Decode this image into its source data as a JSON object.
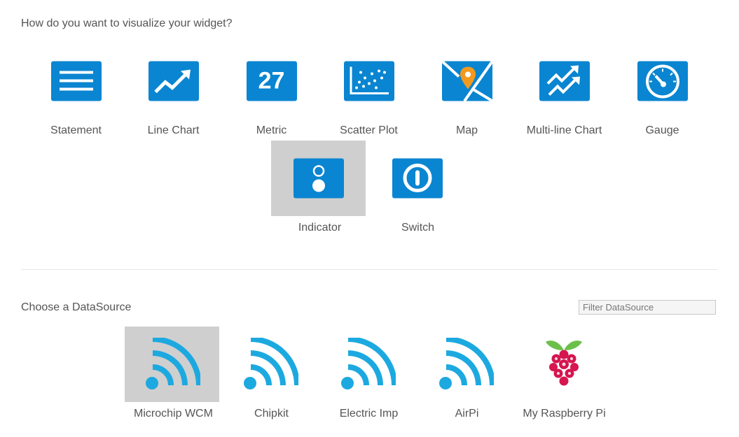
{
  "visualize": {
    "title": "How do you want to visualize your widget?",
    "metric_number": "27",
    "items": [
      {
        "label": "Statement",
        "icon": "statement-icon"
      },
      {
        "label": "Line Chart",
        "icon": "line-chart-icon"
      },
      {
        "label": "Metric",
        "icon": "metric-icon"
      },
      {
        "label": "Scatter Plot",
        "icon": "scatter-plot-icon"
      },
      {
        "label": "Map",
        "icon": "map-icon"
      },
      {
        "label": "Multi-line Chart",
        "icon": "multi-line-chart-icon"
      },
      {
        "label": "Gauge",
        "icon": "gauge-icon"
      },
      {
        "label": "Indicator",
        "icon": "indicator-icon",
        "selected": true
      },
      {
        "label": "Switch",
        "icon": "switch-icon"
      }
    ]
  },
  "datasource": {
    "title": "Choose a DataSource",
    "filter_placeholder": "Filter DataSource",
    "items": [
      {
        "label": "Microchip WCM",
        "icon": "wifi-signal-icon",
        "selected": true
      },
      {
        "label": "Chipkit",
        "icon": "wifi-signal-icon"
      },
      {
        "label": "Electric Imp",
        "icon": "wifi-signal-icon"
      },
      {
        "label": "AirPi",
        "icon": "wifi-signal-icon"
      },
      {
        "label": "My Raspberry Pi",
        "icon": "raspberry-pi-icon"
      }
    ]
  },
  "colors": {
    "icon_blue": "#0a85d1",
    "signal_blue": "#1ca9e0",
    "selected_bg": "#cfcfcf",
    "map_pin": "#f39a1e",
    "raspberry_red": "#d5164f",
    "raspberry_leaf": "#6cc04a"
  }
}
